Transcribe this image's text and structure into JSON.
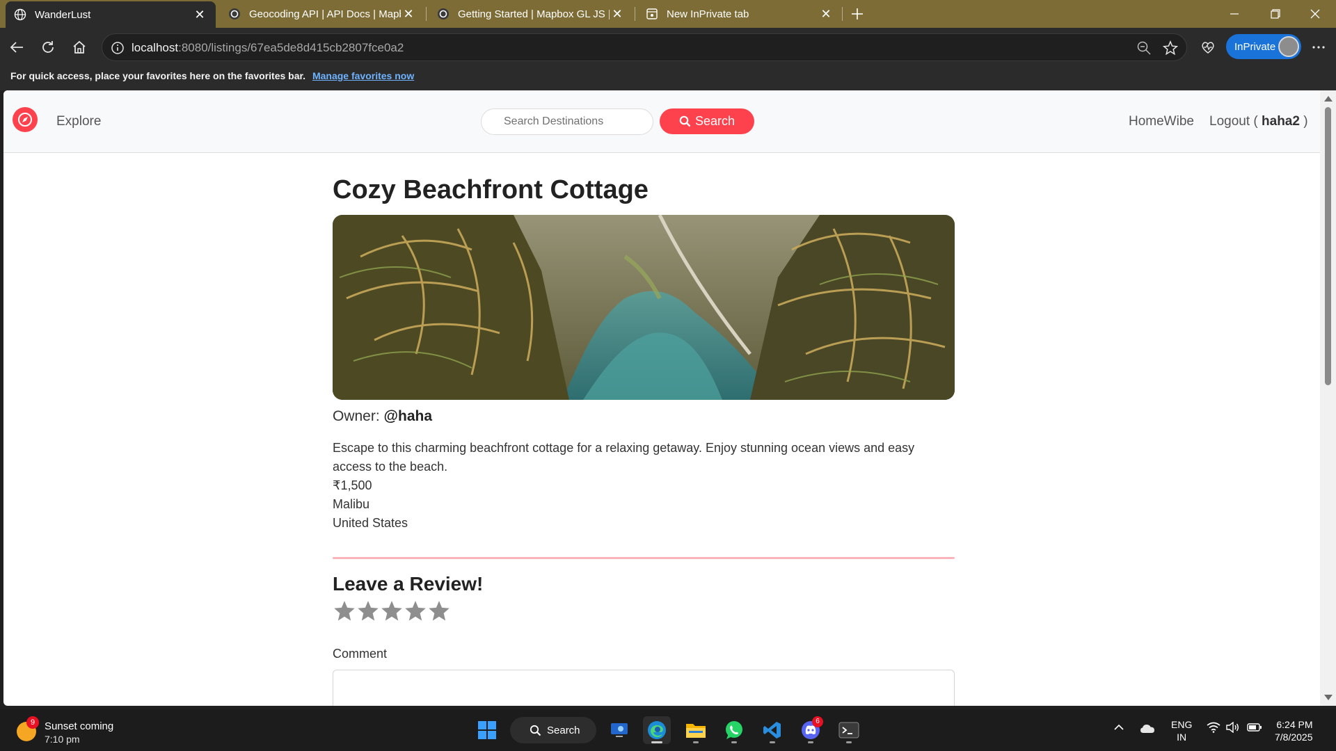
{
  "browser": {
    "tabs": [
      {
        "title": "WanderLust",
        "active": true,
        "icon": "globe-icon"
      },
      {
        "title": "Geocoding API | API Docs | Mapbox",
        "active": false,
        "icon": "mapbox-icon"
      },
      {
        "title": "Getting Started | Mapbox GL JS | Mapbox",
        "active": false,
        "icon": "mapbox-icon"
      },
      {
        "title": "New InPrivate tab",
        "active": false,
        "icon": "inprivate-tab-icon"
      }
    ],
    "url_host": "localhost",
    "url_rest": ":8080/listings/67ea5de8d415cb2807fce0a2",
    "inprivate_label": "InPrivate",
    "favorites_bar_text": "For quick access, place your favorites here on the favorites bar.",
    "favorites_bar_link": "Manage favorites now"
  },
  "site": {
    "nav_explore": "Explore",
    "search_placeholder": "Search Destinations",
    "search_button": "Search",
    "nav_home": "HomeWibe",
    "logout_prefix": "Logout (",
    "logout_user": "haha2",
    "logout_suffix": ")",
    "brand_color": "#fe424d"
  },
  "listing": {
    "title": "Cozy Beachfront Cottage",
    "image_alt": "Tropical lagoon with palm trees",
    "owner_label": "Owner:",
    "owner": "@haha",
    "description": "Escape to this charming beachfront cottage for a relaxing getaway. Enjoy stunning ocean views and easy access to the beach.",
    "price": "₹1,500",
    "location": "Malibu",
    "country": "United States"
  },
  "review": {
    "heading": "Leave a Review!",
    "rating": 0,
    "max_rating": 5,
    "comment_label": "Comment"
  },
  "taskbar": {
    "weather_badge": "9",
    "weather_line1": "Sunset coming",
    "weather_line2": "7:10 pm",
    "search_label": "Search",
    "discord_badge": "6",
    "lang_line1": "ENG",
    "lang_line2": "IN",
    "time": "6:24 PM",
    "date": "7/8/2025"
  }
}
